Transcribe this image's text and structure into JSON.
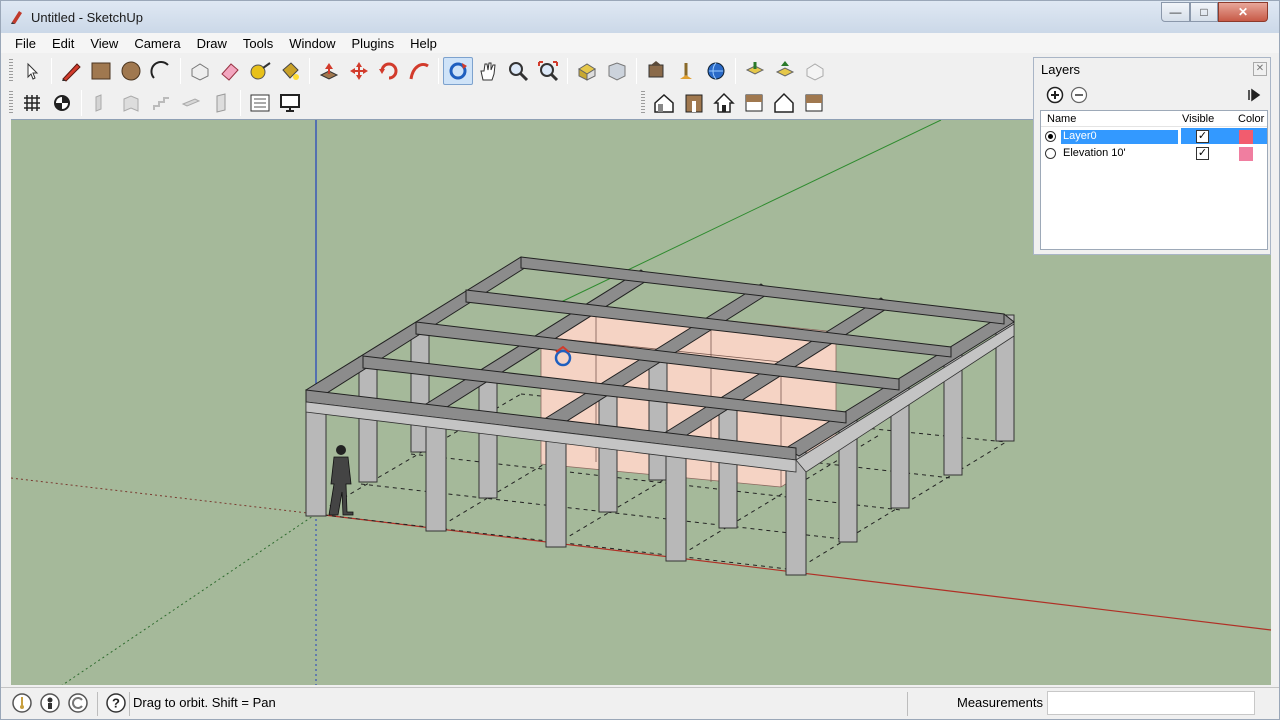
{
  "window": {
    "title": "Untitled - SketchUp"
  },
  "menu": [
    "File",
    "Edit",
    "View",
    "Camera",
    "Draw",
    "Tools",
    "Window",
    "Plugins",
    "Help"
  ],
  "toolbar": {
    "row1": [
      "select-icon",
      "pencil-icon",
      "rectangle-icon",
      "circle-icon",
      "arc-icon",
      "make-component-icon",
      "eraser-icon",
      "tape-measure-icon",
      "paint-bucket-icon",
      "push-pull-icon",
      "move-icon",
      "rotate-icon",
      "follow-me-icon",
      "orbit-icon",
      "pan-icon",
      "zoom-icon",
      "zoom-extents-icon",
      "warehouse-get-icon",
      "warehouse-share-icon",
      "extension-icon",
      "geo-location-icon",
      "photo-texture-icon",
      "download-models-icon",
      "upload-models-icon",
      "share-component-icon"
    ],
    "row2_left": [
      "grid-icon",
      "section-icon",
      "wall-tool-icon",
      "column-tool-icon",
      "stair-tool-icon",
      "beam-tool-icon",
      "door-tool-icon",
      "scenes-list-icon",
      "display-icon"
    ],
    "row2_right": [
      "iso-view-icon",
      "front-view-icon",
      "house-view-icon",
      "top-view-icon",
      "right-view-icon",
      "back-view-icon"
    ]
  },
  "layers": {
    "title": "Layers",
    "columns": {
      "name": "Name",
      "visible": "Visible",
      "color": "Color"
    },
    "rows": [
      {
        "name": "Layer0",
        "active": true,
        "visible": true,
        "color": "#f25c6e"
      },
      {
        "name": "Elevation 10'",
        "active": false,
        "visible": true,
        "color": "#f07ea0"
      }
    ]
  },
  "status": {
    "message": "Drag to orbit.  Shift = Pan",
    "measurements_label": "Measurements",
    "measurements_value": ""
  },
  "colors": {
    "sky_ground": "#a5b99a",
    "axis_red": "#c0392b",
    "axis_green": "#2e8b2e",
    "axis_blue": "#1f3fbf",
    "slab_pink": "#f5d3c4"
  }
}
